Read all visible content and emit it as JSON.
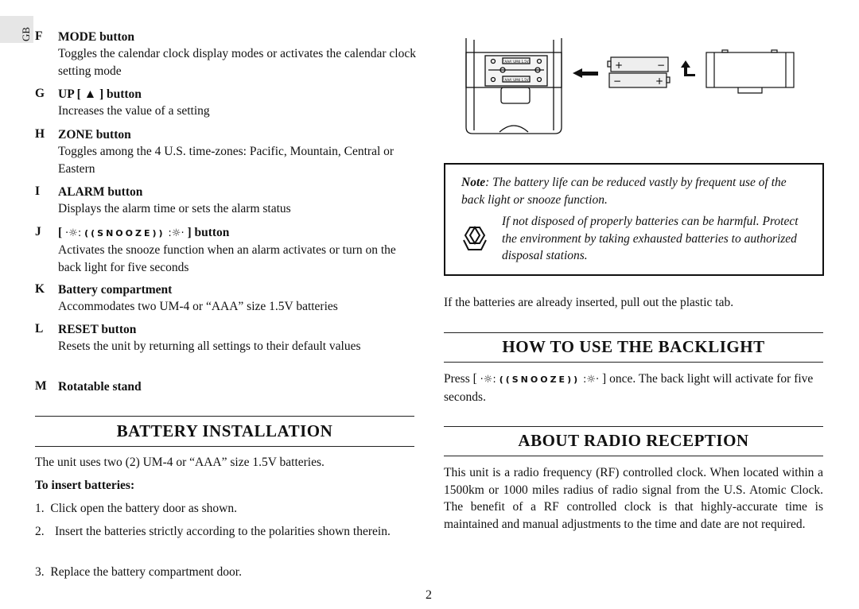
{
  "page": {
    "tab_label": "GB",
    "page_number": "2"
  },
  "components": [
    {
      "letter": "F",
      "title": "MODE button",
      "desc": "Toggles the calendar clock display modes or activates the calendar clock setting mode"
    },
    {
      "letter": "G",
      "title_prefix": "UP [",
      "title_symbol": "▲",
      "title_suffix": "] button",
      "desc": "Increases the value of a setting"
    },
    {
      "letter": "H",
      "title": "ZONE button",
      "desc": "Toggles among the 4 U.S. time-zones: Pacific, Mountain, Central or Eastern"
    },
    {
      "letter": "I",
      "title": "ALARM button",
      "desc": "Displays the alarm time or sets the alarm status"
    },
    {
      "letter": "J",
      "title_prefix": "[",
      "snooze": "((SNOOZE))",
      "title_suffix": "] button",
      "desc": "Activates the snooze function when an alarm activates or turn on the back light for five seconds"
    },
    {
      "letter": "K",
      "title": "Battery compartment",
      "desc": "Accommodates two UM-4 or “AAA” size 1.5V batteries"
    },
    {
      "letter": "L",
      "title": "RESET button",
      "desc": "Resets the unit by returning all settings to their default values"
    },
    {
      "letter": "M",
      "title": "Rotatable stand",
      "desc": ""
    }
  ],
  "battery_installation": {
    "heading": "BATTERY INSTALLATION",
    "intro": "The unit uses two (2) UM-4 or “AAA” size 1.5V batteries.",
    "subheading": "To insert batteries:",
    "steps": [
      {
        "num": "1.",
        "text": "Click open the battery door as shown."
      },
      {
        "num": "2.",
        "text": "Insert the batteries strictly according to the polarities shown therein."
      },
      {
        "num": "3.",
        "text": "Replace the battery compartment door."
      }
    ]
  },
  "illustration": {
    "battery_label": "'AAA' UM4 1.5V",
    "plus": "+",
    "minus": "−"
  },
  "note": {
    "label": "Note",
    "text": ": The battery life can be reduced vastly by frequent use of the back light or snooze function.",
    "recycle_text": "If not disposed of properly batteries can be harmful. Protect the environment by taking exhausted batteries to authorized disposal stations."
  },
  "plastic_tab_text": "If the batteries are already inserted, pull out the plastic tab.",
  "backlight": {
    "heading": "HOW TO USE THE BACKLIGHT",
    "press": "Press [",
    "snooze": "((SNOOZE))",
    "rest": "] once. The back light will activate for five seconds."
  },
  "radio": {
    "heading": "ABOUT RADIO RECEPTION",
    "text": "This unit is a radio frequency (RF) controlled clock. When located within a 1500km or 1000 miles radius of radio signal from the U.S. Atomic Clock. The benefit of a RF controlled clock is that highly-accurate time is maintained and manual adjustments to the time and date are not required."
  }
}
